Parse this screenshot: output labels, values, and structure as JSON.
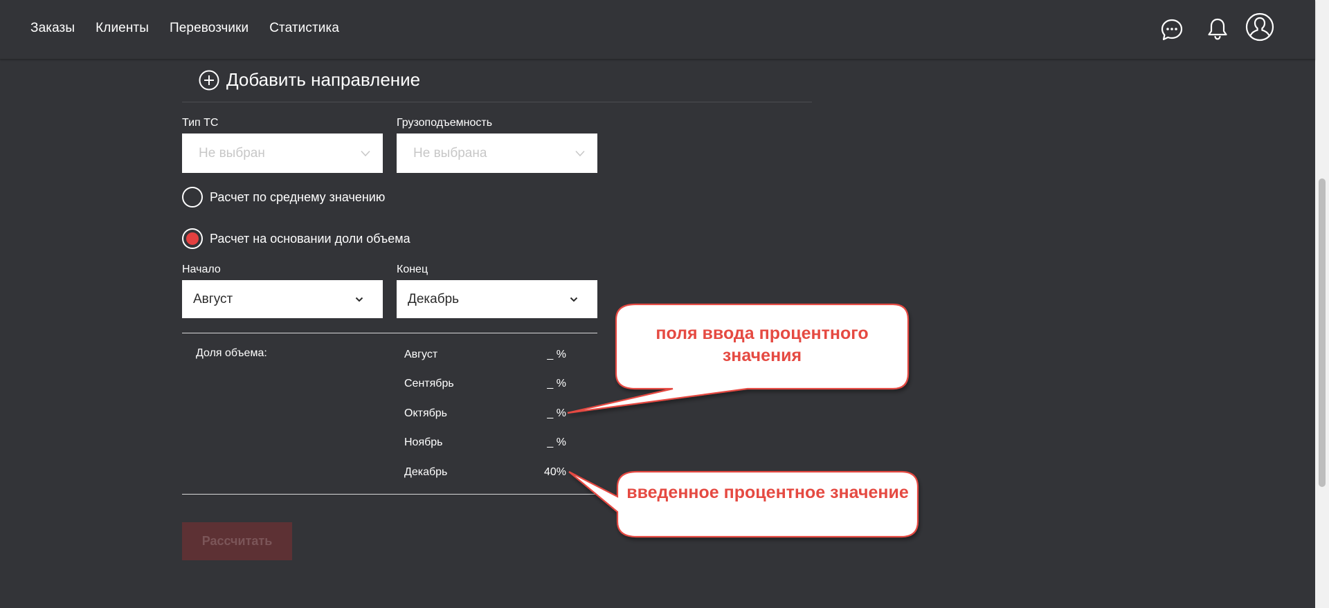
{
  "nav": {
    "items": [
      "Заказы",
      "Клиенты",
      "Перевозчики",
      "Статистика"
    ]
  },
  "icons": {
    "chat": "chat-bubble-icon",
    "bell": "notification-bell-icon",
    "user": "user-profile-icon"
  },
  "add_direction": {
    "label": "Добавить направление"
  },
  "vehicle_type": {
    "label": "Тип ТС",
    "placeholder": "Не выбран"
  },
  "capacity": {
    "label": "Грузоподъемность",
    "placeholder": "Не выбрана"
  },
  "calc_mode": {
    "options": [
      {
        "label": "Расчет по среднему значению",
        "selected": false
      },
      {
        "label": "Расчет на основании доли объема",
        "selected": true
      }
    ]
  },
  "period": {
    "start_label": "Начало",
    "start_value": "Август",
    "end_label": "Конец",
    "end_value": "Декабрь"
  },
  "volume_share": {
    "label": "Доля объема:",
    "months": [
      {
        "name": "Август",
        "value": "_  %"
      },
      {
        "name": "Сентябрь",
        "value": "_  %"
      },
      {
        "name": "Октябрь",
        "value": "_  %"
      },
      {
        "name": "Ноябрь",
        "value": "_  %"
      },
      {
        "name": "Декабрь",
        "value": "40%"
      }
    ]
  },
  "calculate_button": "Рассчитать",
  "annotations": {
    "input_fields": "поля ввода процентного значения",
    "entered_value": "введенное процентное значение"
  },
  "colors": {
    "background": "#333438",
    "accent_red": "#e44040",
    "callout_text": "#e54a42",
    "button_disabled": "#5d3134"
  }
}
